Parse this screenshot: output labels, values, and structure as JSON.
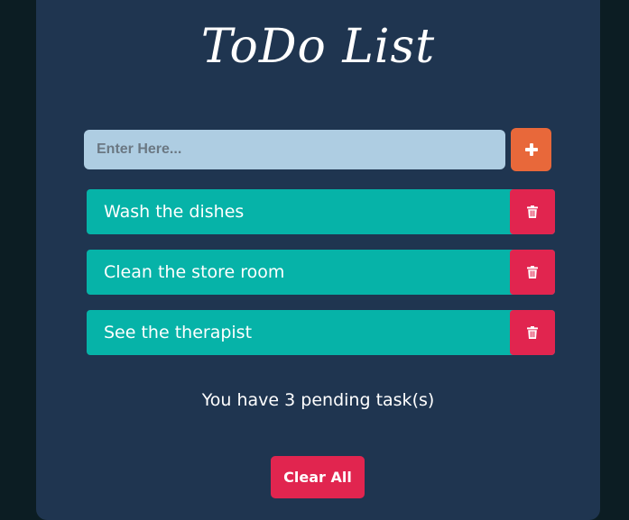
{
  "app": {
    "title": "ToDo List"
  },
  "input": {
    "placeholder": "Enter Here...",
    "value": "",
    "add_icon": "plus-icon"
  },
  "todos": [
    {
      "text": "Wash the dishes",
      "delete_icon": "trash-icon"
    },
    {
      "text": "Clean the store room",
      "delete_icon": "trash-icon"
    },
    {
      "text": "See the therapist",
      "delete_icon": "trash-icon"
    }
  ],
  "footer": {
    "pending_prefix": "You have",
    "pending_count": "3",
    "pending_suffix": "pending task(s)",
    "clear_label": "Clear All"
  },
  "colors": {
    "page_background": "#0c1d23",
    "card_background": "#1f3550",
    "input_background": "#aecde2",
    "add_button": "#e8683a",
    "todo_item": "#06b3a8",
    "delete_button": "#e1254f",
    "clear_button": "#e1254f",
    "text": "#ffffff"
  }
}
